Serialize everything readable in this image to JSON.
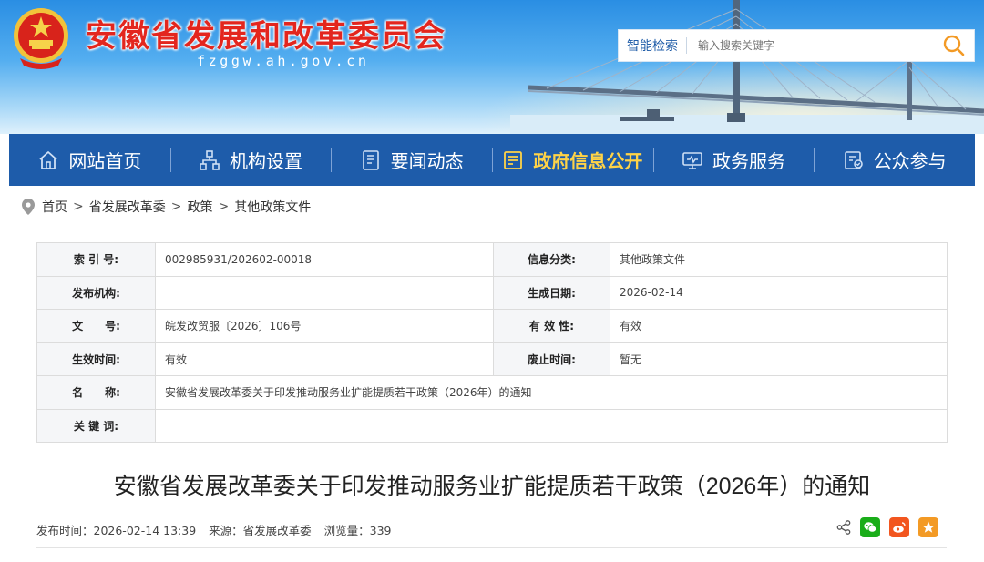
{
  "header": {
    "site_title": "安徽省发展和改革委员会",
    "site_domain": "fzggw.ah.gov.cn",
    "search_label": "智能检索",
    "search_placeholder": "输入搜索关键字"
  },
  "nav": {
    "items": [
      {
        "label": "网站首页",
        "icon": "home-icon"
      },
      {
        "label": "机构设置",
        "icon": "org-chart-icon"
      },
      {
        "label": "要闻动态",
        "icon": "news-icon"
      },
      {
        "label": "政府信息公开",
        "icon": "info-disclosure-icon",
        "active": true
      },
      {
        "label": "政务服务",
        "icon": "monitor-icon"
      },
      {
        "label": "公众参与",
        "icon": "participation-icon"
      }
    ],
    "active_color": "#ffd347",
    "background": "#1e5caa"
  },
  "breadcrumb": [
    "首页",
    "省发展改革委",
    "政策",
    "其他政策文件"
  ],
  "breadcrumb_sep": ">",
  "info": {
    "index_no_label": "索 引 号:",
    "index_no": "002985931/202602-00018",
    "category_label": "信息分类:",
    "category": "其他政策文件",
    "publisher_label": "发布机构:",
    "publisher": "",
    "created_label": "生成日期:",
    "created": "2026-02-14",
    "doc_no_label": "文　　号:",
    "doc_no": "皖发改贸服〔2026〕106号",
    "validity_label": "有 效 性:",
    "validity": "有效",
    "effective_label": "生效时间:",
    "effective": "有效",
    "repeal_label": "废止时间:",
    "repeal": "暂无",
    "name_label": "名　　称:",
    "name": "安徽省发展改革委关于印发推动服务业扩能提质若干政策（2026年）的通知",
    "keywords_label": "关 键 词:",
    "keywords": ""
  },
  "article": {
    "title": "安徽省发展改革委关于印发推动服务业扩能提质若干政策（2026年）的通知",
    "publish_time": "发布时间：2026-02-14 13:39",
    "source": "来源：省发展改革委",
    "views": "浏览量：339"
  },
  "share": {
    "items": [
      "share-icon",
      "wechat-icon",
      "weibo-icon",
      "favorite-icon"
    ],
    "colors": {
      "wechat": "#1aad19",
      "weibo": "#f2561f",
      "favorite": "#f39a25"
    }
  },
  "colors": {
    "title_red": "#e3261e",
    "nav_blue": "#1e5caa",
    "link_blue": "#1f5ca8"
  }
}
